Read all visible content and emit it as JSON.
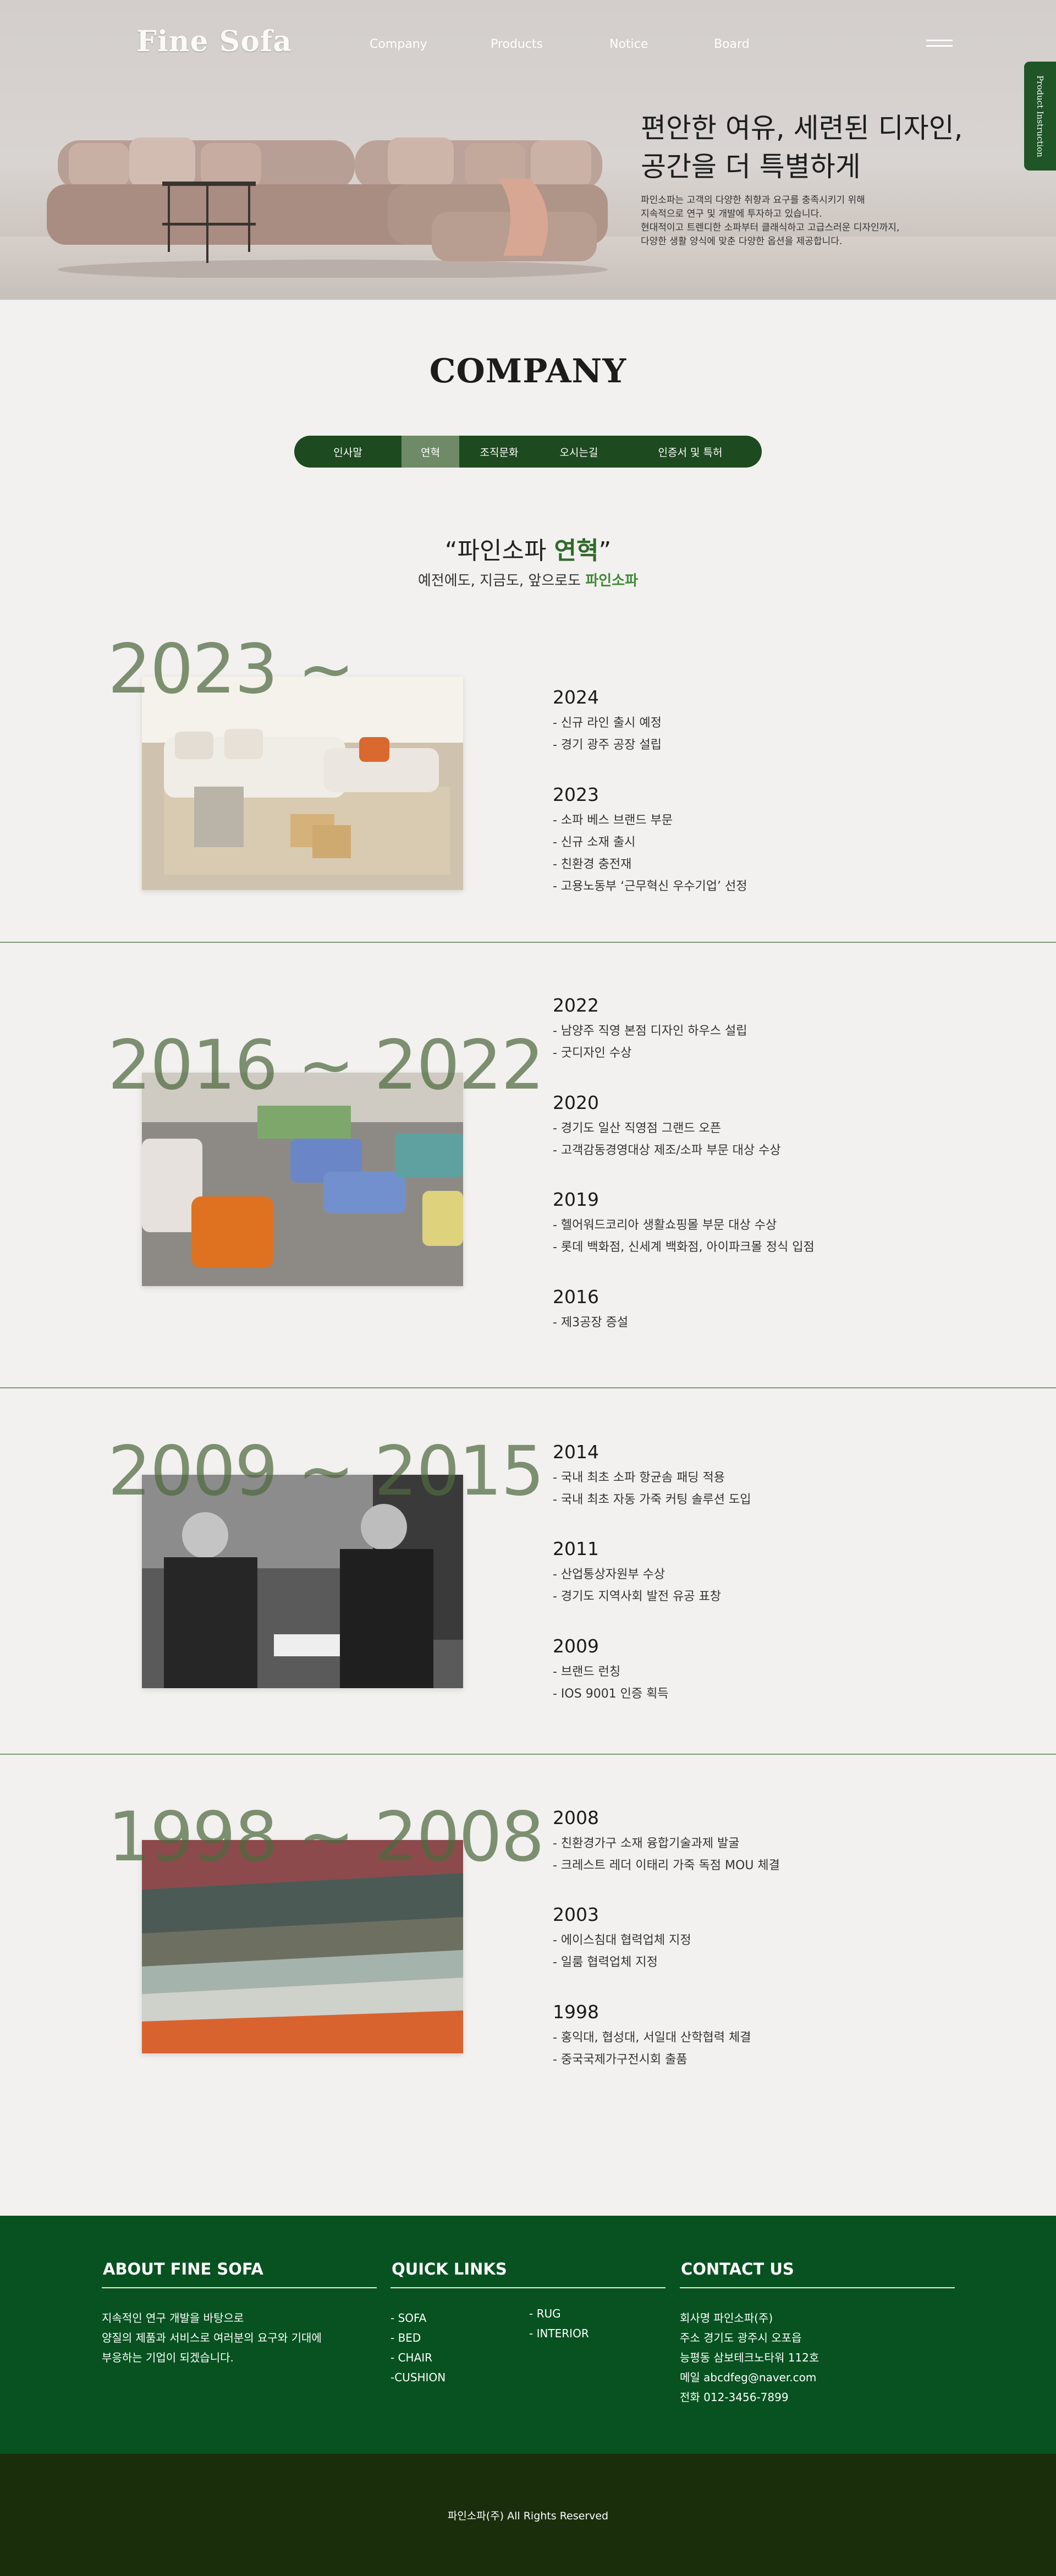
{
  "header": {
    "logo": "Fine Sofa",
    "nav": [
      "Company",
      "Products",
      "Notice",
      "Board"
    ],
    "side_tab": "Product Instruction",
    "hero_title": [
      "편안한 여유, 세련된 디자인,",
      "공간을 더 특별하게"
    ],
    "hero_desc": [
      "파인소파는 고객의 다양한 취향과 요구를 충족시키기 위해",
      "지속적으로 연구 및 개발에 투자하고 있습니다.",
      "현대적이고 트렌디한 소파부터 클래식하고 고급스러운 디자인까지,",
      "다양한 생활 양식에 맞춘 다양한 옵션을 제공합니다."
    ]
  },
  "company": {
    "title": "COMPANY",
    "tabs": [
      "인사말",
      "연혁",
      "조직문화",
      "오시는길",
      "인증서 및 특허"
    ],
    "active_tab": "연혁",
    "history_title_pre": "“파인소파 ",
    "history_title_em": "연혁",
    "history_title_post": "”",
    "history_sub_pre": "예전에도, 지금도, 앞으로도 ",
    "history_sub_em": "파인소파"
  },
  "eras": [
    {
      "label": "2023 ~",
      "photo": "showroom-sofa-photo",
      "entries": [
        {
          "year": "2024",
          "items": [
            "- 신규 라인 출시 예정",
            "- 경기 광주 공장 설립"
          ]
        },
        {
          "year": "2023",
          "items": [
            "- 소파 베스 브랜드 부문",
            "- 신규 소재 출시",
            "- 친환경 충전재",
            "- 고용노동부 ‘근무혁신 우수기업’ 선정"
          ]
        }
      ]
    },
    {
      "label": "2016 ~ 2022",
      "photo": "furniture-store-photo",
      "entries": [
        {
          "year": "2022",
          "items": [
            "- 남양주 직영 본점 디자인 하우스 설립",
            "- 굿디자인 수상"
          ]
        },
        {
          "year": "2020",
          "items": [
            "- 경기도 일산 직영점 그랜드 오픈",
            "- 고객감동경영대상 제조/소파 부문 대상 수상"
          ]
        },
        {
          "year": "2019",
          "items": [
            "- 헬어워드코리아 생활쇼핑몰 부문 대상 수상",
            "- 롯데 백화점, 신세계 백화점, 아이파크몰 정식 입점"
          ]
        },
        {
          "year": "2016",
          "items": [
            "- 제3공장 증설"
          ]
        }
      ]
    },
    {
      "label": "2009 ~ 2015",
      "photo": "award-ceremony-photo",
      "entries": [
        {
          "year": "2014",
          "items": [
            "- 국내 최초 소파 항균솜 패딩 적용",
            "- 국내 최초 자동 가죽 커팅 솔루션 도입"
          ]
        },
        {
          "year": "2011",
          "items": [
            "- 산업통상자원부 수상",
            "- 경기도 지역사회 발전 유공 표창"
          ]
        },
        {
          "year": "2009",
          "items": [
            "- 브랜드 런칭",
            "- IOS 9001 인증 획득"
          ]
        }
      ]
    },
    {
      "label": "1998 ~ 2008",
      "photo": "leather-samples-photo",
      "entries": [
        {
          "year": "2008",
          "items": [
            "- 친환경가구 소재 융합기술과제 발굴",
            "- 크레스트 레더 이태리 가죽 독점 MOU 체결"
          ]
        },
        {
          "year": "2003",
          "items": [
            "- 에이스침대 협력업체 지정",
            "- 일룸 협력업체 지정"
          ]
        },
        {
          "year": "1998",
          "items": [
            "- 홍익대, 협성대, 서일대 산학협력 체결",
            "- 중국국제가구전시회 출품"
          ]
        }
      ]
    }
  ],
  "footer": {
    "about_title": "ABOUT FINE SOFA",
    "about_text": [
      "지속적인 연구 개발을 바탕으로",
      "양질의 제품과 서비스로 여러분의 요구와 기대에",
      "부응하는 기업이 되겠습니다."
    ],
    "links_title": "QUICK LINKS",
    "links_col1": [
      "- SOFA",
      "- BED",
      "- CHAIR",
      "-CUSHION"
    ],
    "links_col2": [
      "- RUG",
      "- INTERIOR"
    ],
    "contact_title": "CONTACT US",
    "contact_text": [
      "회사명 파인소파(주)",
      "주소 경기도 광주시 오포읍",
      "능평동 삼보테크노타워 112호",
      "메일 abcdfeg@naver.com",
      "전화 012-3456-7899"
    ],
    "copyright": "파인소파(주) All Rights Reserved"
  },
  "colors": {
    "brand_green": "#075220",
    "tab_bar": "#1d4a1f",
    "active_tab": "#6f8a66",
    "era_label": "#4e6a3e",
    "copyright_bar": "#1b2e0c"
  }
}
